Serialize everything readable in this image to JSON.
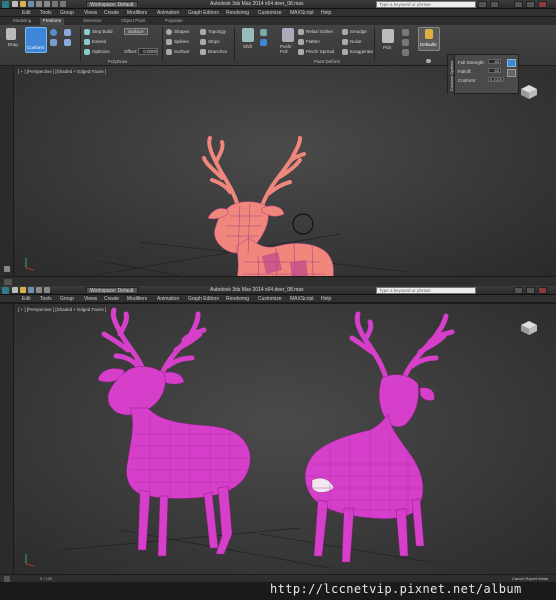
{
  "top_window": {
    "title": "Autodesk 3ds Max 2014 x64      deer_08.max",
    "workspace": "Workspace: Default",
    "search_placeholder": "Type a keyword or phrase",
    "menus": [
      "Edit",
      "Tools",
      "Group",
      "Views",
      "Create",
      "Modifiers",
      "Animation",
      "Graph Editors",
      "Rendering",
      "Customize",
      "MAXScript",
      "Help"
    ],
    "tabs": [
      "Modeling",
      "Freeform",
      "Selection",
      "Object Paint",
      "Populate"
    ],
    "active_tab": "Freeform",
    "ribbon": {
      "drag": "Drag",
      "conform": "Conform",
      "step_build": "Step Build",
      "extend": "Extend",
      "optimize": "Optimize",
      "surface": "Surface",
      "offset_label": "Offset:",
      "offset_value": "0.0000",
      "shapes": "Shapes",
      "splines": "Splines",
      "surface2": "Surface",
      "topology": "Topology",
      "strips": "Strips",
      "branches": "Branches",
      "shift": "Shift",
      "push_pull": "Push/ Pull",
      "relax_soften": "Relax/ Soften",
      "flatten": "Flatten",
      "pinch_spread": "Pinch/ Spread",
      "smudge": "Smudge",
      "noise": "Noise",
      "exaggerate": "Exaggerate",
      "pick": "Pick",
      "defaults": "Defaults",
      "polydraw_label": "PolyDraw",
      "paint_deform_label": "Paint Deform"
    },
    "viewport_label": "[ + ] [Perspective ] [Shaded + Edged Faces ]",
    "conform_options": {
      "title": "Conform Options",
      "full_strength_label": "Full Strength:",
      "full_strength_value": "85",
      "falloff_label": "Falloff:",
      "falloff_value": "85",
      "conform_label": "Conform:",
      "conform_value": "0.1000"
    }
  },
  "bottom_window": {
    "workspace": "Workspace: Default",
    "title": "Autodesk 3ds Max 2014 x64      deer_08.max",
    "search_placeholder": "Type a keyword or phrase",
    "menus": [
      "Edit",
      "Tools",
      "Group",
      "Views",
      "Create",
      "Modifiers",
      "Animation",
      "Graph Editors",
      "Rendering",
      "Customize",
      "MAXScript",
      "Help"
    ],
    "viewport_label": "[ + ] [Perspective ] [Shaded + Edged Faces ]",
    "status_left": "0 / 100",
    "status_right": "Cancel Expert Mode"
  },
  "watermark": "http://lccnetvip.pixnet.net/album",
  "colors": {
    "deer_top": "#f0877c",
    "deer_top_mesh": "#c24a8a",
    "deer_bottom": "#d63fc9",
    "viewport_bg": "#3b3b3b",
    "ribbon_bg": "#3f3f3f",
    "accent_blue": "#3d86d8"
  }
}
